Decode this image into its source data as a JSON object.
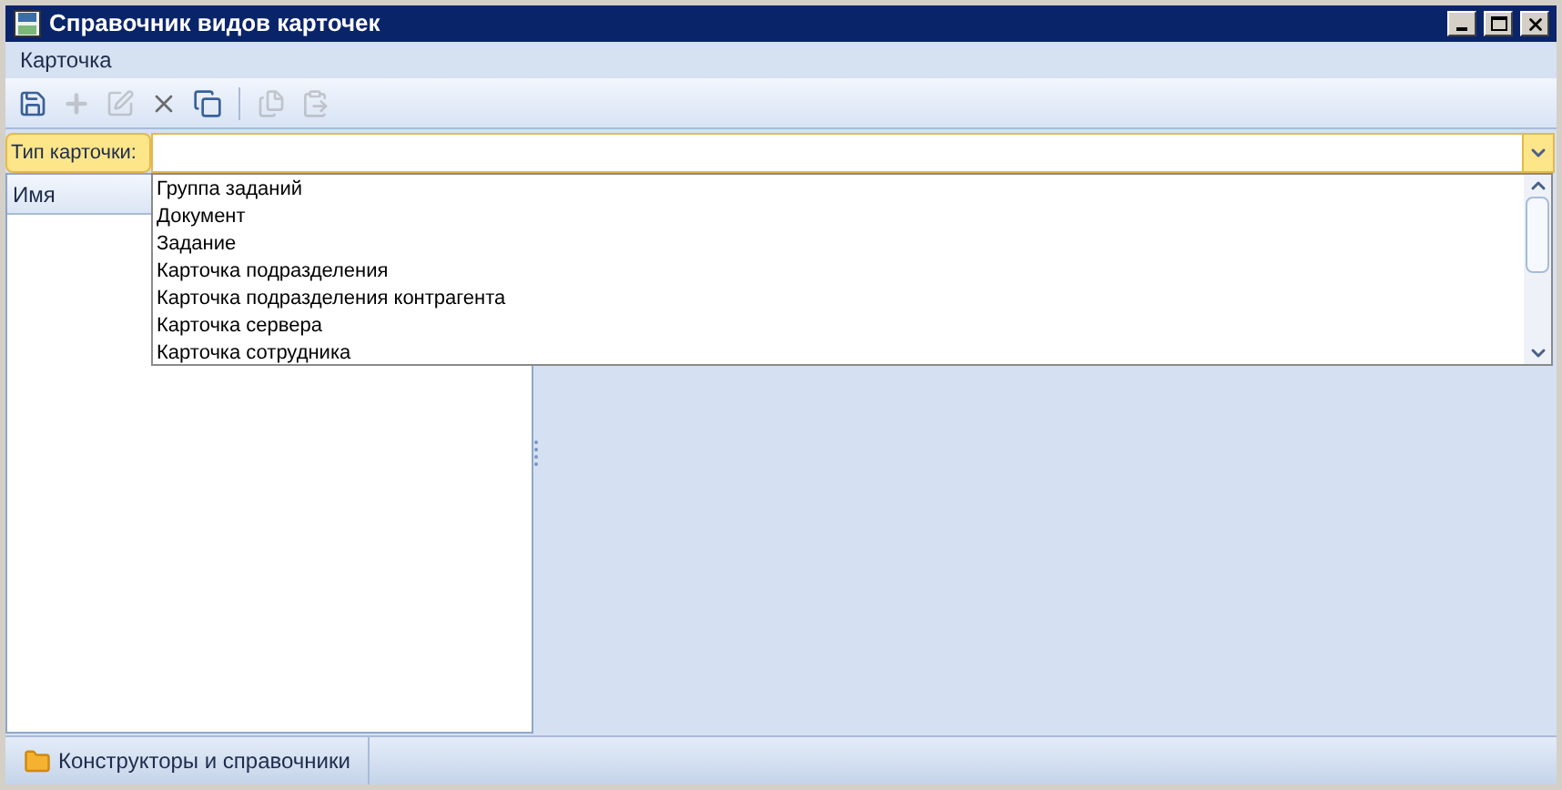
{
  "window": {
    "title": "Справочник видов карточек"
  },
  "menu": [
    {
      "label": "Карточка"
    }
  ],
  "toolbar": [
    {
      "kind": "save",
      "disabled": false
    },
    {
      "kind": "add",
      "disabled": true
    },
    {
      "kind": "edit",
      "disabled": true
    },
    {
      "kind": "delete",
      "disabled": false
    },
    {
      "kind": "duplicate",
      "disabled": false
    },
    {
      "kind": "separator"
    },
    {
      "kind": "copy",
      "disabled": true
    },
    {
      "kind": "paste",
      "disabled": true
    }
  ],
  "card_type_field": {
    "label": "Тип карточки:",
    "options_open": true,
    "options": [
      "Группа заданий",
      "Документ",
      "Задание",
      "Карточка подразделения",
      "Карточка подразделения контрагента",
      "Карточка сервера",
      "Карточка сотрудника"
    ]
  },
  "table": {
    "columns": [
      "Имя"
    ]
  },
  "status_bar": {
    "items": [
      {
        "label": "Конструкторы и справочники"
      }
    ]
  }
}
